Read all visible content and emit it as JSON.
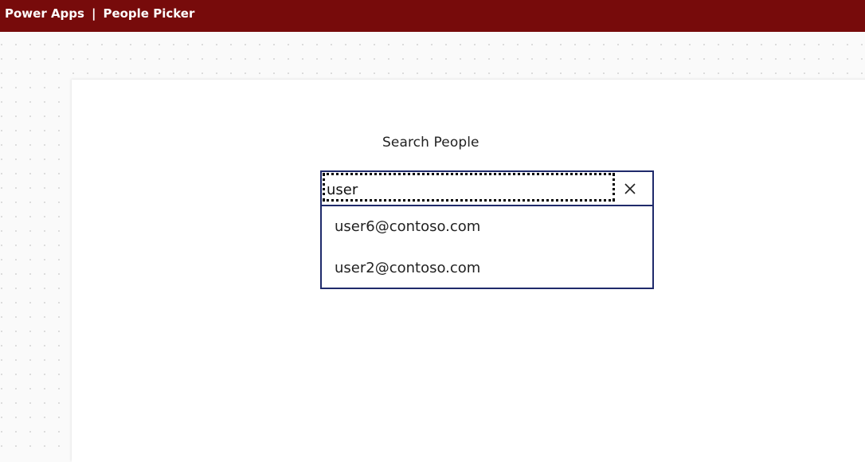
{
  "header": {
    "app_name": "Power Apps",
    "separator": "|",
    "page_name": "People Picker",
    "background_color": "#770b0b"
  },
  "form": {
    "search_label": "Search People",
    "input_value": "user",
    "clear_icon": "close-icon",
    "border_color": "#1f2a6b"
  },
  "results": [
    {
      "email": "user6@contoso.com"
    },
    {
      "email": "user2@contoso.com"
    }
  ]
}
